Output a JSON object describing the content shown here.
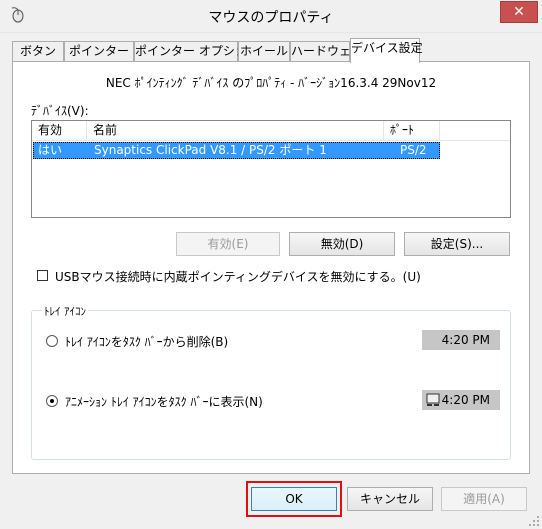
{
  "window": {
    "title": "マウスのプロパティ",
    "app_icon": "mouse-icon",
    "close_label": "✕"
  },
  "tabs": [
    {
      "label": "ボタン"
    },
    {
      "label": "ポインター"
    },
    {
      "label": "ポインター オプション"
    },
    {
      "label": "ホイール"
    },
    {
      "label": "ハードウェア"
    },
    {
      "label": "デバイス設定",
      "active": true
    }
  ],
  "device_settings": {
    "info_line": "NEC ﾎﾟｲﾝﾃｨﾝｸﾞ ﾃﾞﾊﾞｲｽ のﾌﾟﾛﾊﾟﾃｨ - ﾊﾞｰｼﾞｮﾝ16.3.4 29Nov12",
    "devices_label": "ﾃﾞﾊﾞｲｽ(V):",
    "columns": [
      "有効",
      "名前",
      "ﾎﾟｰﾄ"
    ],
    "rows": [
      {
        "enabled": "はい",
        "name": "Synaptics ClickPad V8.1 / PS/2 ポート 1",
        "port": "PS/2",
        "selected": true
      }
    ],
    "buttons": {
      "enable": "有効(E)",
      "disable": "無効(D)",
      "settings": "設定(S)..."
    },
    "usb_checkbox": {
      "label": "USBマウス接続時に内蔵ポインティングデバイスを無効にする。(U)",
      "checked": false
    },
    "tray_group": {
      "title": "ﾄﾚｲ ｱｲｺﾝ",
      "option_remove": {
        "label": "ﾄﾚｲ ｱｲｺﾝをﾀｽｸ ﾊﾞｰから削除(B)",
        "checked": false
      },
      "option_show": {
        "label": "ｱﾆﾒｰｼｮﾝ ﾄﾚｲ ｱｲｺﾝをﾀｽｸ ﾊﾞｰに表示(N)",
        "checked": true
      },
      "preview_time": "4:20 PM",
      "tray_icon": "touchpad-icon"
    }
  },
  "footer": {
    "ok": "OK",
    "cancel": "キャンセル",
    "apply": "適用(A)"
  },
  "colors": {
    "selection": "#3399ff",
    "highlight_outline": "#e01010"
  }
}
